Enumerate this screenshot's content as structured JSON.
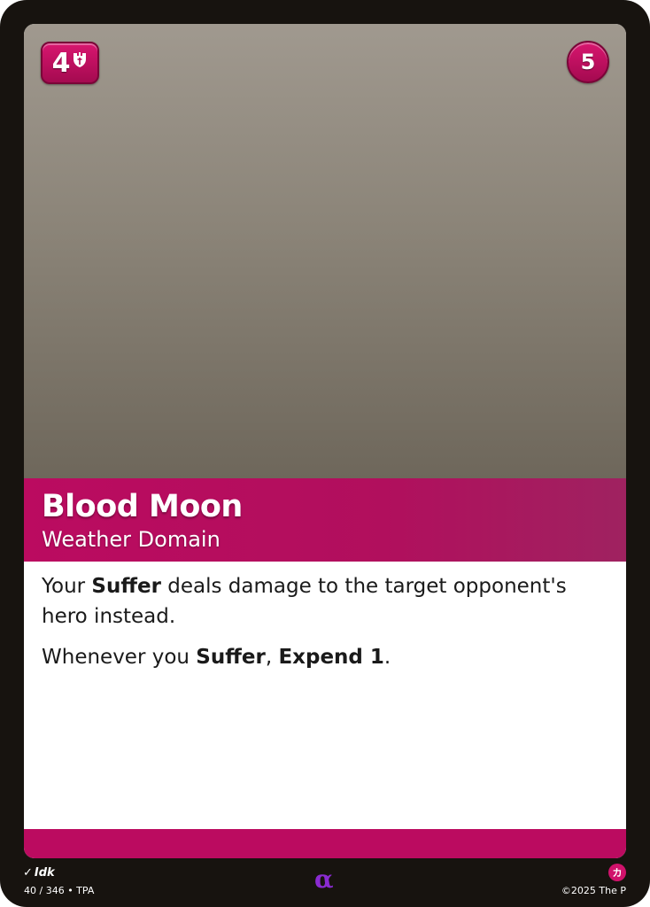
{
  "card": {
    "cost": "4",
    "cost_icon": "shield-sword-icon",
    "power": "5",
    "title": "Blood Moon",
    "subtitle": "Weather Domain",
    "rules": [
      [
        {
          "t": "Your ",
          "b": false
        },
        {
          "t": "Suffer",
          "b": true
        },
        {
          "t": " deals damage to the target opponent's hero instead.",
          "b": false
        }
      ],
      [
        {
          "t": "Whenever you ",
          "b": false
        },
        {
          "t": "Suffer",
          "b": true
        },
        {
          "t": ", ",
          "b": false
        },
        {
          "t": "Expend 1",
          "b": true
        },
        {
          "t": ".",
          "b": false
        }
      ]
    ]
  },
  "footer": {
    "artist": "Idk",
    "collector_info": "40 / 346 • TPA",
    "rarity_symbol": "α",
    "set_symbol": "カ",
    "copyright": "©2025 The P"
  },
  "colors": {
    "accent": "#bb0b60",
    "frame": "#17130f",
    "rarity": "#8a2bd1"
  }
}
